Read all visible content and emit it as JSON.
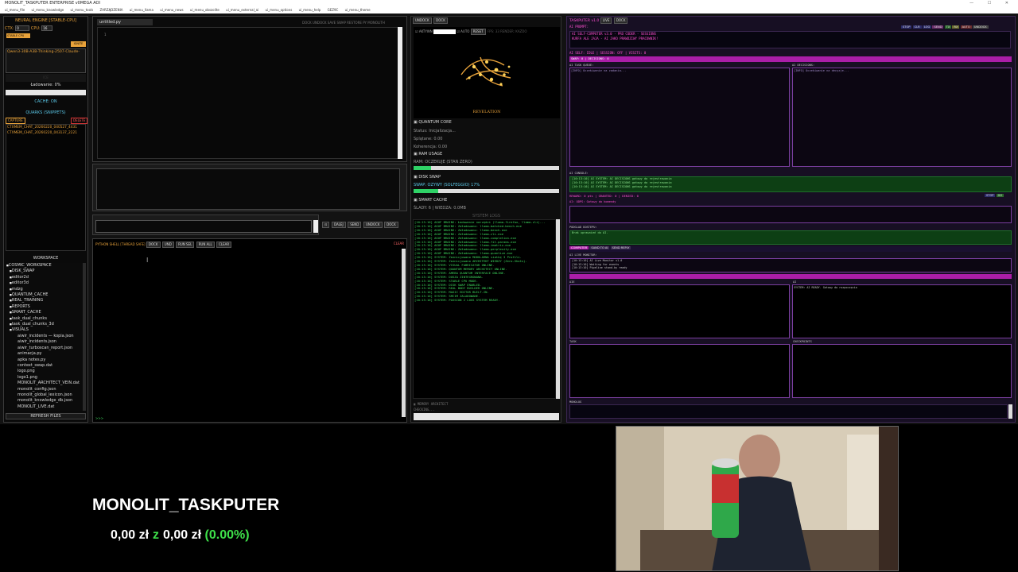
{
  "window": {
    "title": "MONOLIT_TASKPUTER ENTERPRISE v0MEGA AOI",
    "controls": "— ☐ ✕"
  },
  "menu": [
    "ui_menu_file",
    "ui_menu_knowledge",
    "ui_menu_tools",
    "ZARZĄDZENIA",
    "ui_menu_llama",
    "ui_menu_news",
    "ui_menu_obszolite",
    "ui_menu_external_ai",
    "ui_menu_options",
    "ui_menu_help",
    "GEZ9C",
    "ui_menu_theme"
  ],
  "neural": {
    "title": "NEURAL ENGINE [STABLE-CPU]",
    "ctx_label": "CTX:",
    "ctx_value": "0",
    "cpu_label": "CPU:",
    "cpu_value": "16",
    "stable": "STABLE CPU",
    "ignite": "IGNITE",
    "model": "Qwen3-30B-A3B-Thinking-2507-Claude-",
    "ram_small": "ICE",
    "loading": "Ładowanie: 0%",
    "cache_on": "CACHE: ON",
    "quarks": "QUARKS (SNIPPETS)",
    "capture": "CAPTURE",
    "delete": "DELETE",
    "snippets": [
      "CTXMEM_CHAT_20260220_040527_4431",
      "CTXMEM_CHAT_20260220_043137_2221"
    ]
  },
  "workspace": {
    "title": "WORKSPACE",
    "root": "COSMIC_WORKSPACE",
    "folders": [
      "DISK_SWAP",
      "editor2d",
      "editor3d",
      "mdzg",
      "QUANTUM_CACHE",
      "REAL_TRAINING",
      "REPORTS",
      "SMART_CACHE",
      "task_dual_chunks",
      "task_dual_chunks_3d",
      "VISUALS"
    ],
    "files": [
      "aiwir_incidents — kopia.json",
      "aiwir_incidents.json",
      "aiwir_turboscan_report.json",
      "animacja.py",
      "apka notes.py",
      "context_swap.dat",
      "logo.png",
      "logo1.png",
      "MONOLIT_ARCHITECT_VEIN.dat",
      "monolit_config.json",
      "monolit_global_lexicon.json",
      "monolit_knowledge_db.json",
      "MONOLIT_LIVE.dat"
    ],
    "refresh": "REFRESH FILES"
  },
  "editor": {
    "tab": "untitled.py",
    "line_no": "1",
    "tools": [
      "DOCK",
      "UNDOCK",
      "SAVE",
      "SWAP",
      "RESTORE",
      "PY",
      "MONOLITH"
    ],
    "send_buttons": [
      "DALEJ",
      "SEND",
      "UNDOCK",
      "DOCK"
    ],
    "shell_title": "PYTHON SHELL [THREAD SAFE]",
    "shell_buttons": [
      "DOCK",
      "UND",
      "RUN SEL",
      "RUN ALL",
      "CLEAR"
    ],
    "shell_exit": "CLEAR",
    "prompt": ">>>"
  },
  "quantum": {
    "undock": "UNDOCK",
    "dock": "DOCK",
    "akt": "AKTYWN",
    "auto": "AUTO",
    "reset": "RESET",
    "fps": "FPS: 33",
    "render": "RENDER: KAZDO",
    "revelation": "REVELATION",
    "core_title": "QUANTUM CORE",
    "status": "Status: Inicjalizacja...",
    "splatane": "Splątane: 0.00",
    "koherencja": "Koherencja: 0.00",
    "ram_title": "RAM USAGE",
    "ram_text": "RAM: OCZEKUJE (STAN ZERO)",
    "ram_fill": 0.12,
    "swap_title": "DISK SWAP",
    "swap_text": "SWAP: OZYWY (SOLFEGGIO) 17%",
    "swap_fill": 0.17,
    "cache_title": "SMART CACHE",
    "cache_text": "ŚLADY: 6 | WIEDZA: 0.0MB",
    "logs_title": "SYSTEM LOGS",
    "logs": [
      "[10:13:10] AGUF BRAINS: Ładowanie narzędzi (llama-firefox, llama-cli)...",
      "[10:13:10] AGUF BRAINS: Załadowano: llama-batched-bench.exe",
      "[10:13:10] AGUF BRAINS: Załadowano: llama-bench.exe",
      "[10:13:10] AGUF BRAINS: Załadowano: llama-cli.exe",
      "[10:13:10] AGUF BRAINS: Załadowano: llama-completion.exe",
      "[10:13:10] AGUF BRAINS: Załadowano: llama-fit-params.exe",
      "[10:13:10] AGUF BRAINS: Załadowano: llama-imatrix.exe",
      "[10:13:10] AGUF BRAINS: Załadowano: llama-perplexity.exe",
      "[10:13:10] AGUF BRAINS: Załadowano: llama-quantize.exe",
      "[10:13:10] SYSTEM: Zainicjowano MODULARNA siatkę 3 Profili.",
      "[10:13:10] SYSTEM: Zainicjowano ARCHITEKT WIEDZY (Zero-Shots).",
      "[10:13:10] SYSTEM: VISUAL FABRICATOR ONLINE.",
      "[10:13:10] SYSTEM: QUANTUM MEMORY ARCHITECT ONLINE.",
      "[10:13:10] SYSTEM: AMEBA QUANTUM INTERFACE ONLINE.",
      "[10:13:10] SYSTEM: DUSZA ZINTEGROWANA.",
      "[10:13:10] SYSTEM: STABLE CPU MODE.",
      "[10:13:10] SYSTEM: DISK SWAP ENABLED.",
      "[10:13:10] SYSTEM: REAL BODY BUILDER ONLINE.",
      "[10:13:10] SYSTEM: MAGIC EDITOR BUILT-IN.",
      "[10:13:10] SYSTEM: SMCIM ZALADOWANE.",
      "[10:13:10] SYSTEM: PASSION 2 LOGS SYSTEM READY."
    ],
    "memory_title": "MEMORY ARCHITECT",
    "memory_status": "CHECKING..."
  },
  "taskputer": {
    "title": "TASKPUTER v1.0",
    "header_buttons": [
      "LIVE",
      "DOCK"
    ],
    "ai_prompt": "AI PROMPT:",
    "hdr1": "AI SELF-COMPUTER v3.0 · PRO CODER · SESSIONS",
    "hdr2": "KURFA ALE JAJA - AI JAKO PRAWDZIWY PRACOWNIK!",
    "right_buttons": [
      "STOP",
      "CLR",
      "LOG",
      "SEND",
      "TX",
      "RX",
      "AUTO",
      "UNDOCK"
    ],
    "self_status": "AI SELF: IDLE | SESSION: OFF | VISITS: 0",
    "swap_status": "SWAP: 0 | DECISIONS: 0",
    "task_queue": "AI TASK QUEUE:",
    "decisions": "AI DECISIONS:",
    "queue_note": "[INFO] Oczekiwanie na zadania...",
    "decisions_note": "[INFO] Oczekiwanie na decyzje...",
    "console_title": "AI CONSOLE:",
    "console_lines": [
      "[10:13:10] AI SYSTEM: AI DECISIONS gotowy do rejestrowania",
      "[10:13:10] AI SYSTEM: AI DECISIONS gotowy do rejestrowania",
      "[10:13:10] AI SYSTEM: AI DECISIONS gotowy do rejestrowania"
    ],
    "reward_bar": "REWARD: 0 pts | GRANTED: 0 | DENIED: 0",
    "reward_buttons": [
      "STOP",
      "GO"
    ],
    "oczk": "AI: ODPS: Gotowy do komendy",
    "access_title": "PODGLAD DOSTEPU:",
    "access_text": "Brak uprawnień do AI.",
    "bar_tabs": [
      "COMPUTER",
      "SAND TO AI",
      "SEND REPLY"
    ],
    "live_title": "AI LIVE MONITOR:",
    "live_lines": [
      "[10:13:10] AI Live Monitor v1.0",
      "[10:13:10] Waiting for events",
      "[10:13:10] Pipeline stand-by ready"
    ],
    "box_a": "AIE",
    "box_b": "AI",
    "box_b_line": "SYSTEM: AI READY. Gotowy do rozpoczęcia",
    "box_c": "TASK",
    "box_d": "CHECKPOINTS",
    "bottom": "MONOLOG"
  },
  "overlay": {
    "brand": "MONOLIT_TASKPUTER",
    "amount_current": "0,00 zł",
    "z": "z",
    "amount_goal": "0,00 zł",
    "percent": "(0.00%)"
  },
  "colors": {
    "accent_orange": "#e8a23a",
    "log_green": "#3fdc5f",
    "progress_green": "#2fd266",
    "taskputer_pink": "#ff4fd1",
    "donation_green": "#3ee04a"
  }
}
